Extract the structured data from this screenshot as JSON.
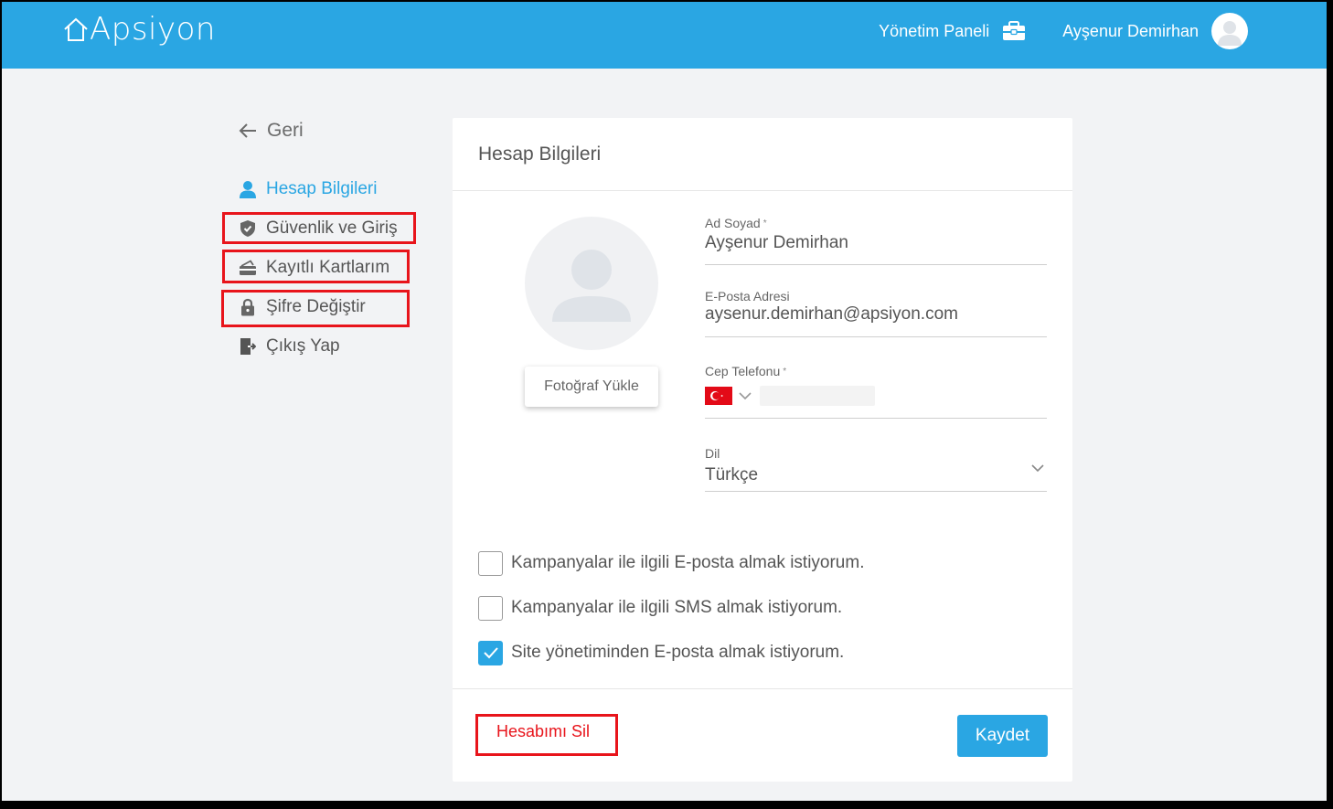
{
  "header": {
    "logo_text": "Apsiyon",
    "panel_link": "Yönetim Paneli",
    "user_name": "Ayşenur Demirhan"
  },
  "sidebar": {
    "back_label": "Geri",
    "items": [
      {
        "label": "Hesap Bilgileri",
        "icon": "user-icon",
        "active": true
      },
      {
        "label": "Güvenlik ve Giriş",
        "icon": "shield-icon",
        "active": false
      },
      {
        "label": "Kayıtlı Kartlarım",
        "icon": "card-icon",
        "active": false
      },
      {
        "label": "Şifre Değiştir",
        "icon": "lock-icon",
        "active": false
      },
      {
        "label": "Çıkış Yap",
        "icon": "logout-icon",
        "active": false
      }
    ]
  },
  "card": {
    "title": "Hesap Bilgileri",
    "upload_label": "Fotoğraf Yükle",
    "fields": {
      "name": {
        "label": "Ad Soyad",
        "required_mark": "*",
        "value": "Ayşenur Demirhan"
      },
      "email": {
        "label": "E-Posta Adresi",
        "value": "aysenur.demirhan@apsiyon.com"
      },
      "phone": {
        "label": "Cep Telefonu",
        "required_mark": "*",
        "country": "TR"
      },
      "language": {
        "label": "Dil",
        "value": "Türkçe"
      }
    },
    "checkboxes": [
      {
        "label": "Kampanyalar ile ilgili E-posta almak istiyorum.",
        "checked": false
      },
      {
        "label": "Kampanyalar ile ilgili SMS almak istiyorum.",
        "checked": false
      },
      {
        "label": "Site yönetiminden E-posta almak istiyorum.",
        "checked": true
      }
    ],
    "delete_label": "Hesabımı Sil",
    "save_label": "Kaydet"
  },
  "colors": {
    "accent": "#2aa6e3",
    "highlight": "#e8141b",
    "background": "#f2f3f5"
  }
}
